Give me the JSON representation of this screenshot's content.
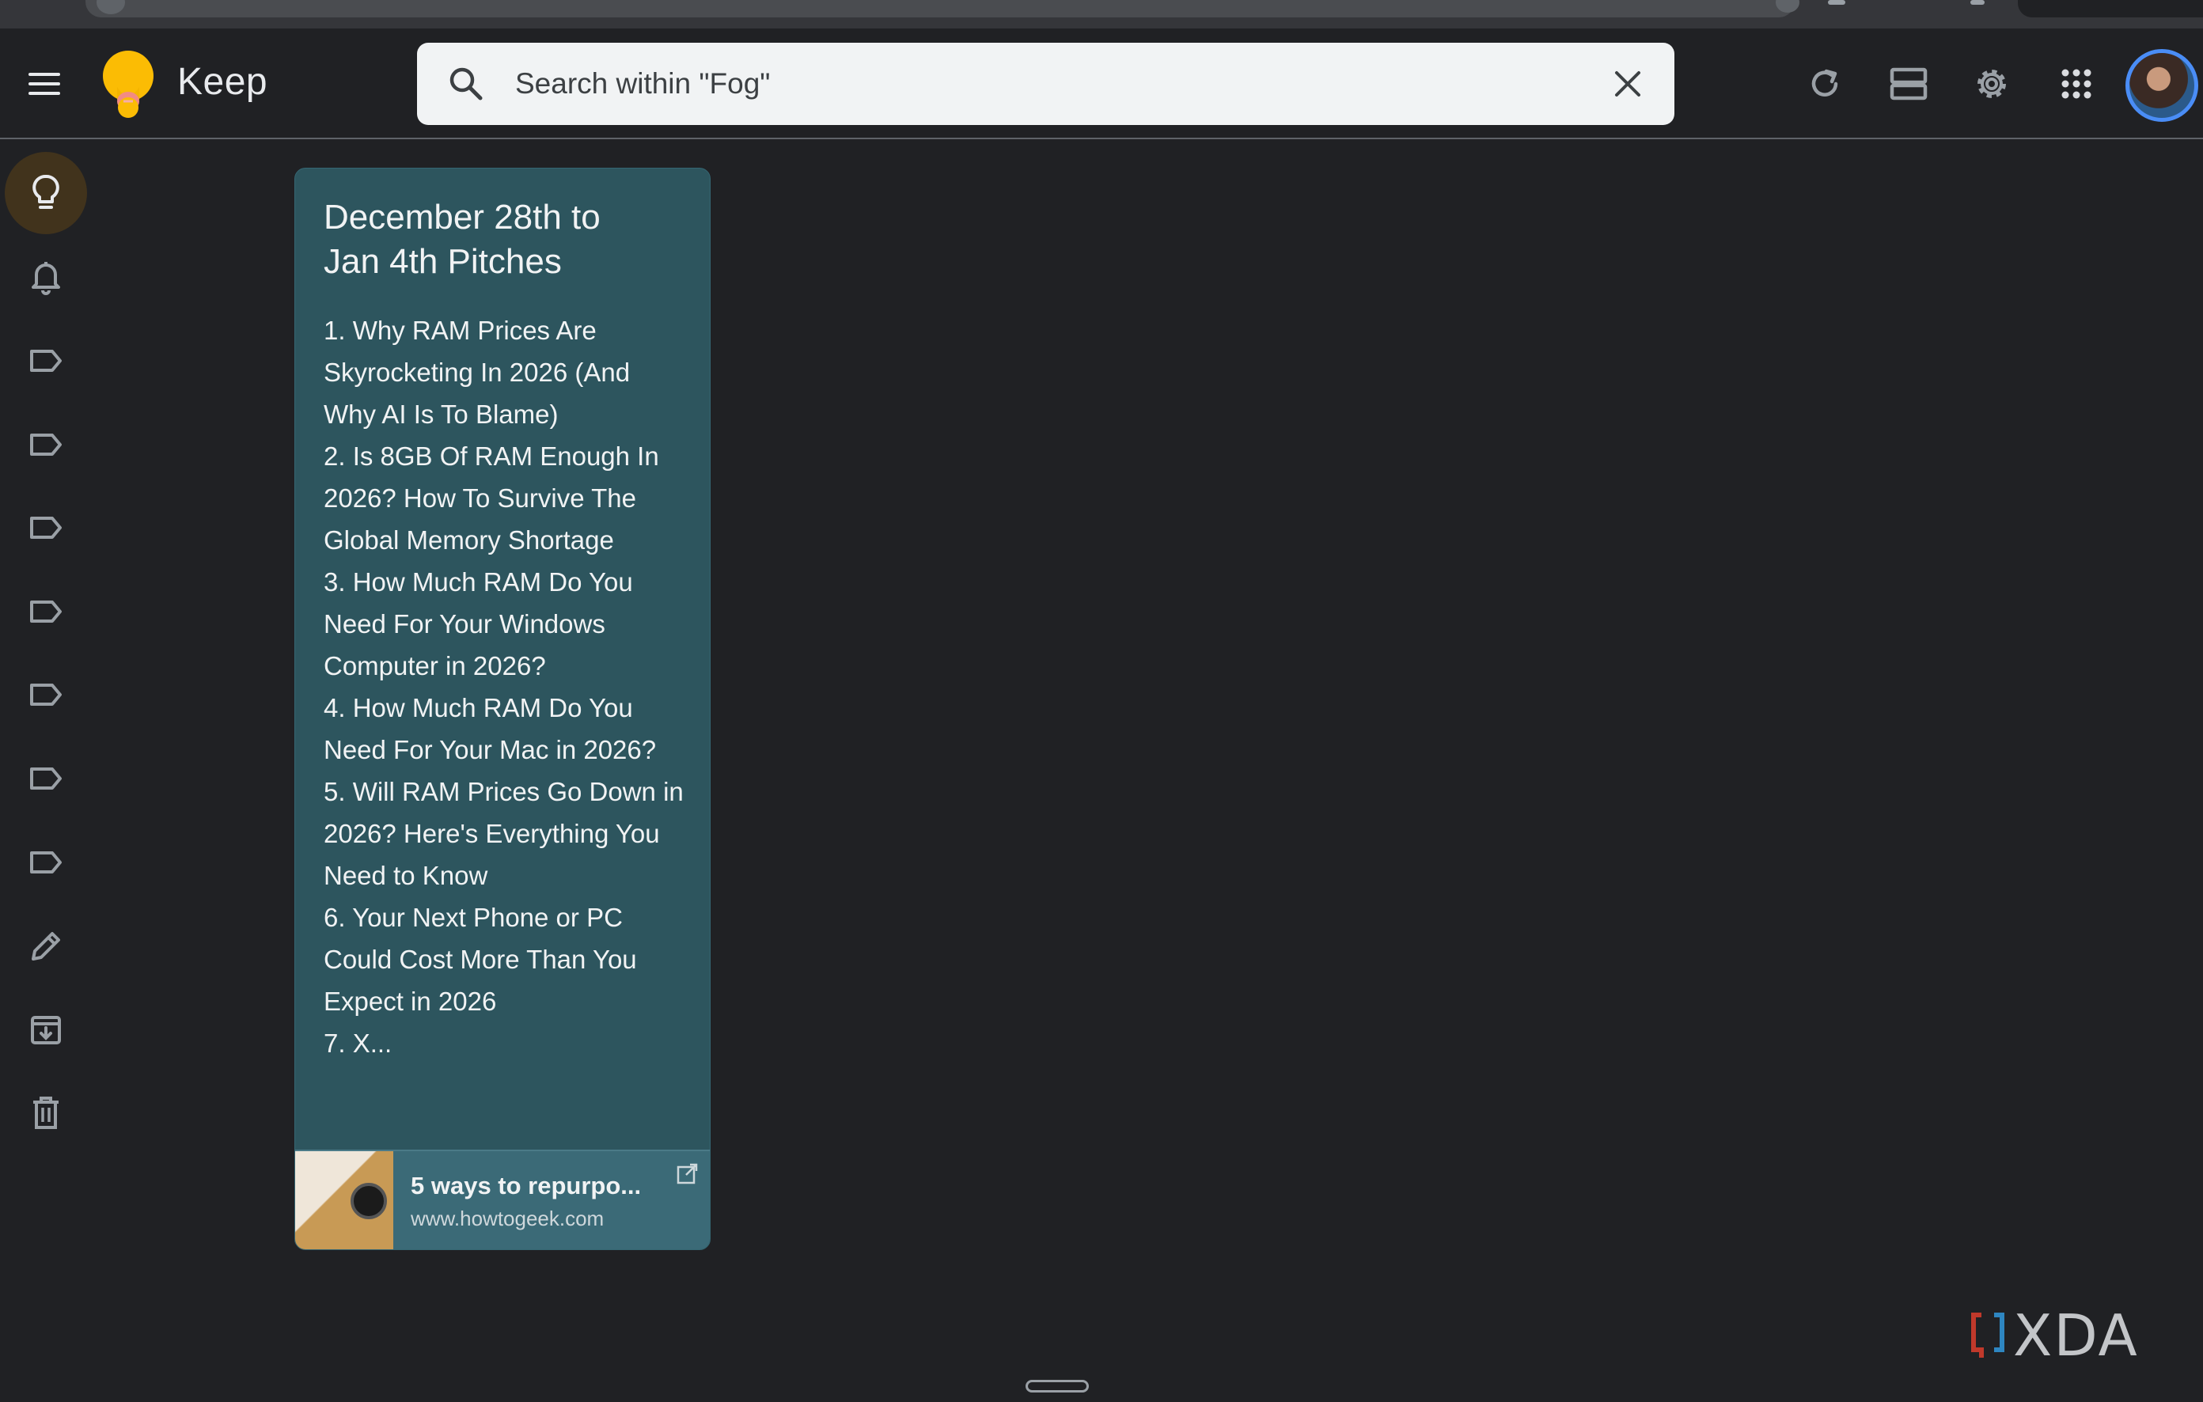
{
  "app": {
    "title": "Keep"
  },
  "header": {
    "search": {
      "placeholder": "Search within \"Fog\"",
      "value": ""
    },
    "icons": [
      "refresh-icon",
      "list-view-icon",
      "settings-icon",
      "apps-grid-icon",
      "account-avatar"
    ]
  },
  "sidebar": {
    "items": [
      {
        "name": "notes",
        "icon": "lightbulb-icon",
        "active": true
      },
      {
        "name": "reminders",
        "icon": "bell-icon"
      },
      {
        "name": "label-1",
        "icon": "label-icon"
      },
      {
        "name": "label-2",
        "icon": "label-icon"
      },
      {
        "name": "label-3",
        "icon": "label-icon"
      },
      {
        "name": "label-4",
        "icon": "label-icon"
      },
      {
        "name": "label-5",
        "icon": "label-icon"
      },
      {
        "name": "label-6",
        "icon": "label-icon"
      },
      {
        "name": "label-7",
        "icon": "label-icon"
      },
      {
        "name": "edit-labels",
        "icon": "pencil-icon"
      },
      {
        "name": "archive",
        "icon": "archive-icon"
      },
      {
        "name": "trash",
        "icon": "trash-icon"
      }
    ]
  },
  "note": {
    "color": "#2d555e",
    "title_lines": [
      "December 28th to",
      "Jan 4th Pitches"
    ],
    "body_lines": [
      "1. Why RAM Prices Are",
      "Skyrocketing In 2026 (And",
      "Why AI Is To Blame)",
      "2. Is 8GB Of RAM Enough In",
      "2026? How To Survive The",
      "Global Memory Shortage",
      "3. How Much RAM Do You",
      "Need For Your Windows",
      "Computer in 2026?",
      "4. How Much RAM Do You",
      "Need For Your Mac in 2026?",
      "5. Will RAM Prices Go Down in",
      "2026? Here's Everything You",
      "Need to Know",
      "6. Your Next Phone or PC",
      "Could Cost More Than You",
      "Expect in 2026",
      "7. X..."
    ],
    "link": {
      "title": "5 ways to repurpo...",
      "url": "www.howtogeek.com"
    }
  },
  "watermark": {
    "text": "XDA"
  }
}
